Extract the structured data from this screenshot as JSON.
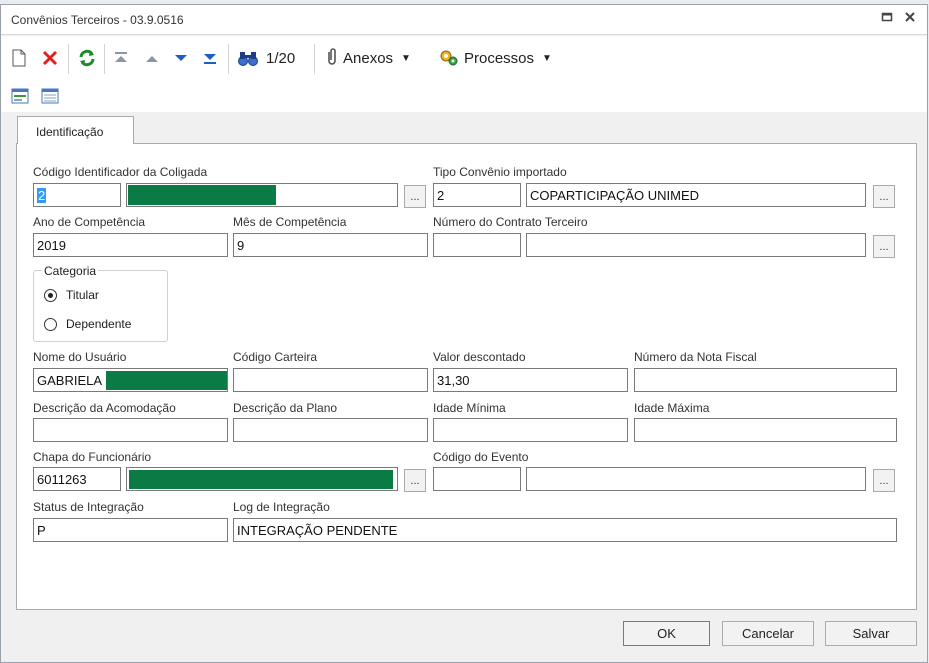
{
  "window": {
    "title": "Convênios Terceiros - 03.9.0516",
    "maximize_icon": "restore-icon",
    "close_icon": "close-icon"
  },
  "toolbar": {
    "record_counter": "1/20",
    "attachments_label": "Anexos",
    "processes_label": "Processos",
    "icons": [
      "new-document-icon",
      "delete-icon",
      "refresh-icon",
      "first-record-icon",
      "previous-record-icon",
      "next-record-icon",
      "last-record-icon",
      "search-binoculars-icon",
      "paperclip-icon",
      "processes-icon"
    ]
  },
  "tabs": {
    "identificacao": "Identificação"
  },
  "form": {
    "codigo_coligada": {
      "label": "Código Identificador da Coligada",
      "value": "2"
    },
    "tipo_convenio": {
      "label": "Tipo Convênio importado",
      "code": "2",
      "description": "COPARTICIPAÇÃO UNIMED"
    },
    "ano_competencia": {
      "label": "Ano de Competência",
      "value": "2019"
    },
    "mes_competencia": {
      "label": "Mês de Competência",
      "value": "9"
    },
    "numero_contrato": {
      "label": "Número do Contrato Terceiro",
      "code": "",
      "description": ""
    },
    "categoria": {
      "label": "Categoria",
      "options": [
        "Titular",
        "Dependente"
      ],
      "selected": "Titular"
    },
    "nome_usuario": {
      "label": "Nome do Usuário",
      "value": "GABRIELA"
    },
    "codigo_carteira": {
      "label": "Código Carteira",
      "value": ""
    },
    "valor_descontado": {
      "label": "Valor descontado",
      "value": "31,30"
    },
    "numero_nota_fiscal": {
      "label": "Número da Nota Fiscal",
      "value": ""
    },
    "descricao_acomodacao": {
      "label": "Descrição da Acomodação",
      "value": ""
    },
    "descricao_plano": {
      "label": "Descrição da Plano",
      "value": ""
    },
    "idade_minima": {
      "label": "Idade Mínima",
      "value": ""
    },
    "idade_maxima": {
      "label": "Idade Máxima",
      "value": ""
    },
    "chapa_funcionario": {
      "label": "Chapa do Funcionário",
      "value": "6011263"
    },
    "codigo_evento": {
      "label": "Código do Evento",
      "code": "",
      "description": ""
    },
    "status_integracao": {
      "label": "Status de Integração",
      "value": "P"
    },
    "log_integracao": {
      "label": "Log de Integração",
      "value": "INTEGRAÇÃO PENDENTE"
    },
    "lookup_button": "..."
  },
  "buttons": {
    "ok": "OK",
    "cancel": "Cancelar",
    "save": "Salvar"
  },
  "colors": {
    "redaction": "#0b7a45",
    "selection": "#3399ff"
  }
}
